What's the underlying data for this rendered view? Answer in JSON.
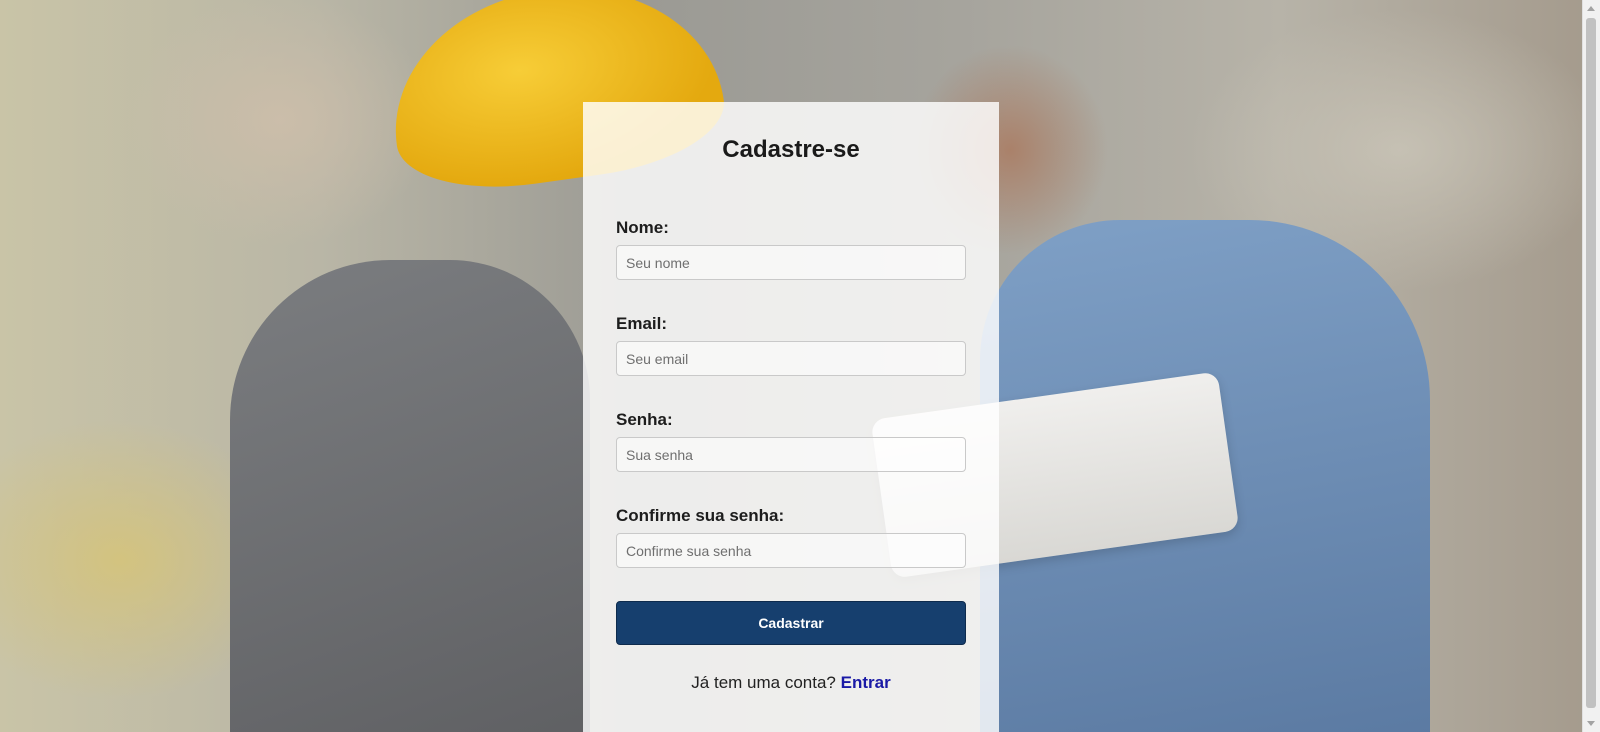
{
  "form": {
    "title": "Cadastre-se",
    "fields": [
      {
        "label": "Nome:",
        "placeholder": "Seu nome",
        "value": ""
      },
      {
        "label": "Email:",
        "placeholder": "Seu email",
        "value": ""
      },
      {
        "label": "Senha:",
        "placeholder": "Sua senha",
        "value": ""
      },
      {
        "label": "Confirme sua senha:",
        "placeholder": "Confirme sua senha",
        "value": ""
      }
    ],
    "submit_label": "Cadastrar",
    "login_prompt": "Já tem uma conta?",
    "login_link": "Entrar"
  },
  "colors": {
    "button": "#163f6e",
    "link": "#1a1aa6",
    "panel": "#ffffff"
  }
}
